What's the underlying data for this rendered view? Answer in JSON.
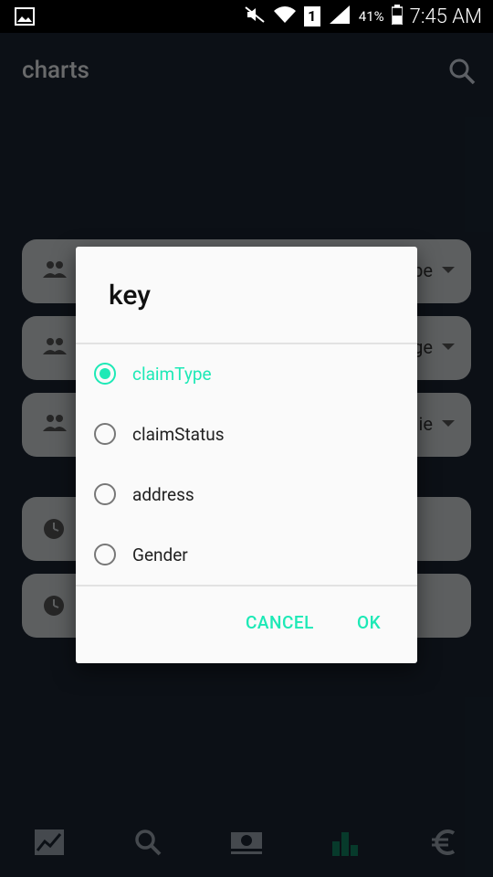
{
  "status_bar": {
    "battery_percent": "41%",
    "sim": "1",
    "time": "7:45 AM"
  },
  "app_bar": {
    "title": "charts"
  },
  "cards": [
    {
      "value": "pe"
    },
    {
      "value": "ge"
    },
    {
      "value": "ie"
    },
    {
      "value": ""
    },
    {
      "value": ""
    }
  ],
  "dialog": {
    "title": "key",
    "selected_index": 0,
    "options": [
      {
        "label": "claimType",
        "selected": true
      },
      {
        "label": "claimStatus",
        "selected": false
      },
      {
        "label": "address",
        "selected": false
      },
      {
        "label": "Gender",
        "selected": false
      }
    ],
    "cancel_label": "CANCEL",
    "ok_label": "OK"
  },
  "bottom_nav": [
    {
      "icon": "line-chart-icon",
      "active": false
    },
    {
      "icon": "search-icon",
      "active": false
    },
    {
      "icon": "money-icon",
      "active": false
    },
    {
      "icon": "bar-chart-icon",
      "active": true
    },
    {
      "icon": "euro-icon",
      "active": false
    }
  ],
  "colors": {
    "accent": "#1de9b6",
    "background": "#1b2532",
    "dialog": "#fafafa"
  }
}
